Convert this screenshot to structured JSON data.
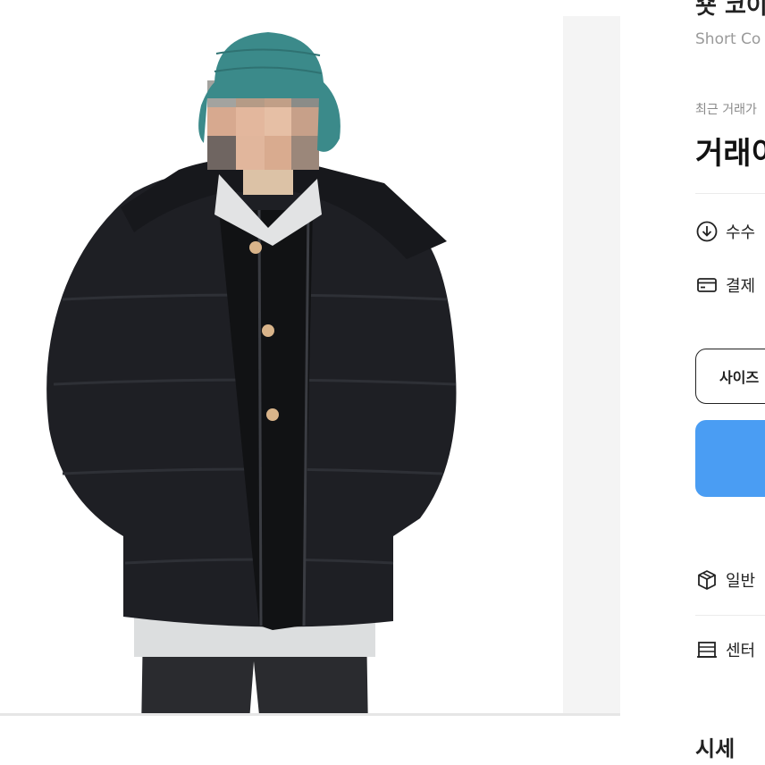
{
  "product": {
    "title": "숏 코이",
    "subtitle": "Short Co",
    "recent_price_label": "최근 거래가",
    "price_text": "거래이"
  },
  "info_rows": {
    "fee": "수수",
    "payment": "결제",
    "delivery": "일반",
    "center": "센터"
  },
  "buttons": {
    "size": "사이즈"
  },
  "sections": {
    "market_price": "시세"
  },
  "colors": {
    "accent": "#4a9df3",
    "image_bg": "#f4f4f4",
    "hat": "#3b8a8a",
    "jacket": "#1e1f24"
  }
}
